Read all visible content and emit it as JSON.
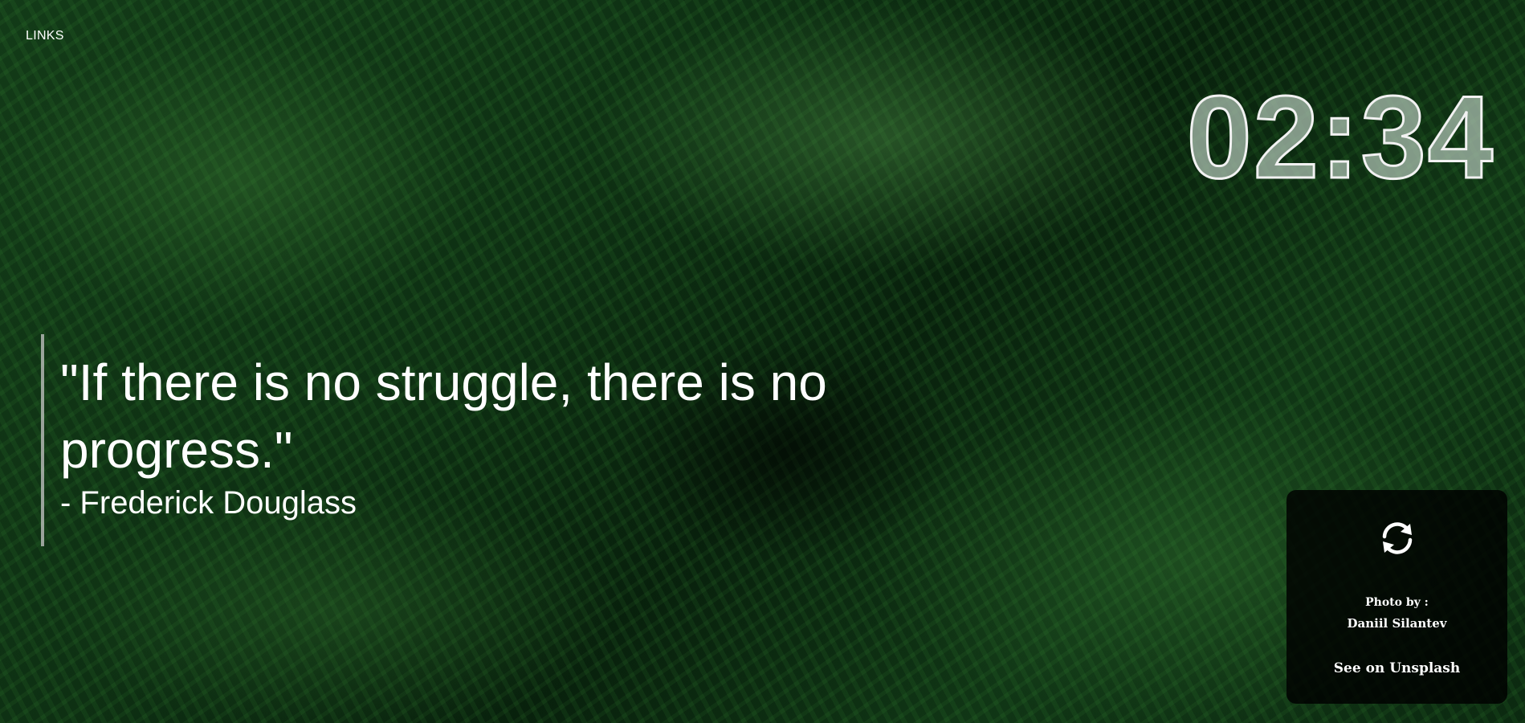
{
  "nav": {
    "links_label": "LINKS"
  },
  "clock": {
    "time": "02:34"
  },
  "quote": {
    "text": "\"If there is no struggle, there is no progress.\"",
    "author": "- Frederick Douglass"
  },
  "photo_credit": {
    "refresh_icon": "refresh-icon",
    "photo_by_label": "Photo by :",
    "photographer": "Daniil Silantev",
    "unsplash_link": "See on Unsplash"
  },
  "colors": {
    "background": "#0f3314",
    "text": "#ffffff",
    "card": "#000000"
  }
}
